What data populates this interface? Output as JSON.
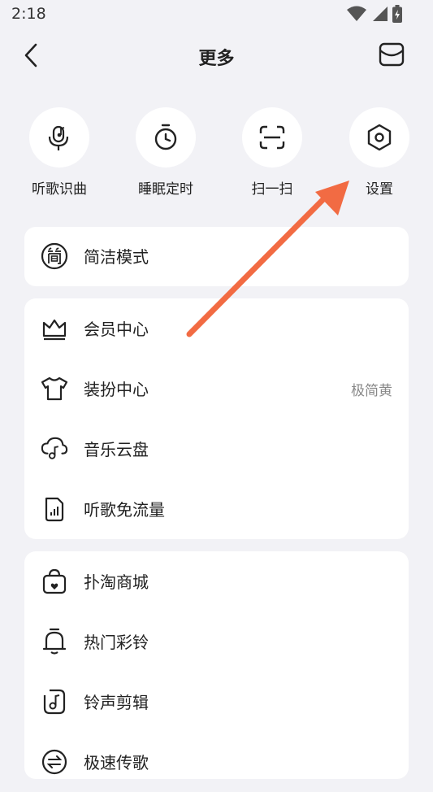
{
  "status_bar": {
    "time": "2:18",
    "icons": [
      "wifi-icon",
      "signal-icon",
      "battery-icon"
    ]
  },
  "header": {
    "title": "更多",
    "back_icon": "back-arrow-icon",
    "message_icon": "message-box-icon"
  },
  "quick_actions": [
    {
      "label": "听歌识曲",
      "icon": "microphone-note-icon"
    },
    {
      "label": "睡眠定时",
      "icon": "timer-icon"
    },
    {
      "label": "扫一扫",
      "icon": "scan-icon"
    },
    {
      "label": "设置",
      "icon": "hexagon-settings-icon"
    }
  ],
  "card1": {
    "items": [
      {
        "label": "简洁模式",
        "icon": "simple-mode-icon"
      }
    ]
  },
  "card2": {
    "items": [
      {
        "label": "会员中心",
        "icon": "crown-icon"
      },
      {
        "label": "装扮中心",
        "icon": "tshirt-icon",
        "value": "极简黄"
      },
      {
        "label": "音乐云盘",
        "icon": "cloud-music-icon"
      },
      {
        "label": "听歌免流量",
        "icon": "data-chart-icon"
      }
    ]
  },
  "card3": {
    "items": [
      {
        "label": "扑淘商城",
        "icon": "shopping-bag-icon"
      },
      {
        "label": "热门彩铃",
        "icon": "bell-icon"
      },
      {
        "label": "铃声剪辑",
        "icon": "ringtone-edit-icon"
      },
      {
        "label": "极速传歌",
        "icon": "transfer-icon"
      }
    ]
  },
  "colors": {
    "background": "#f2f2f6",
    "card": "#ffffff",
    "annotation_arrow": "#f26b43"
  }
}
